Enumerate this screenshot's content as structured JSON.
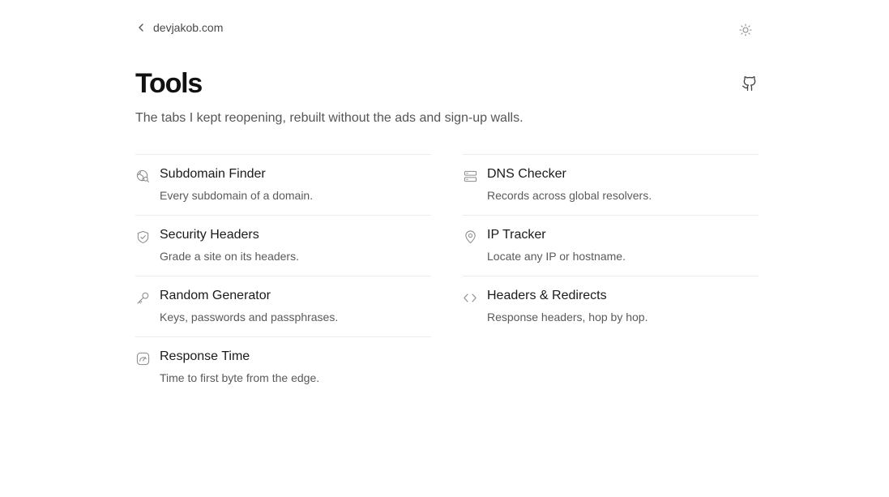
{
  "nav": {
    "back_label": "devjakob.com",
    "back_icon": "chevron-left-icon",
    "theme_icon": "sun-icon"
  },
  "header": {
    "title": "Tools",
    "subtitle": "The tabs I kept reopening, rebuilt without the ads and sign-up walls.",
    "github_icon": "github-icon"
  },
  "tools": [
    {
      "name": "Subdomain Finder",
      "description": "Every subdomain of a domain.",
      "icon": "globe-search-icon"
    },
    {
      "name": "DNS Checker",
      "description": "Records across global resolvers.",
      "icon": "server-icon"
    },
    {
      "name": "Security Headers",
      "description": "Grade a site on its headers.",
      "icon": "shield-check-icon"
    },
    {
      "name": "IP Tracker",
      "description": "Locate any IP or hostname.",
      "icon": "map-pin-icon"
    },
    {
      "name": "Random Generator",
      "description": "Keys, passwords and passphrases.",
      "icon": "key-icon"
    },
    {
      "name": "Headers & Redirects",
      "description": "Response headers, hop by hop.",
      "icon": "code-icon"
    },
    {
      "name": "Response Time",
      "description": "Time to first byte from the edge.",
      "icon": "gauge-icon"
    }
  ],
  "colors": {
    "text": "#1a1a1a",
    "muted": "#5a5a5a",
    "icon": "#8a8a8a",
    "divider": "#ececec",
    "background": "#ffffff"
  }
}
